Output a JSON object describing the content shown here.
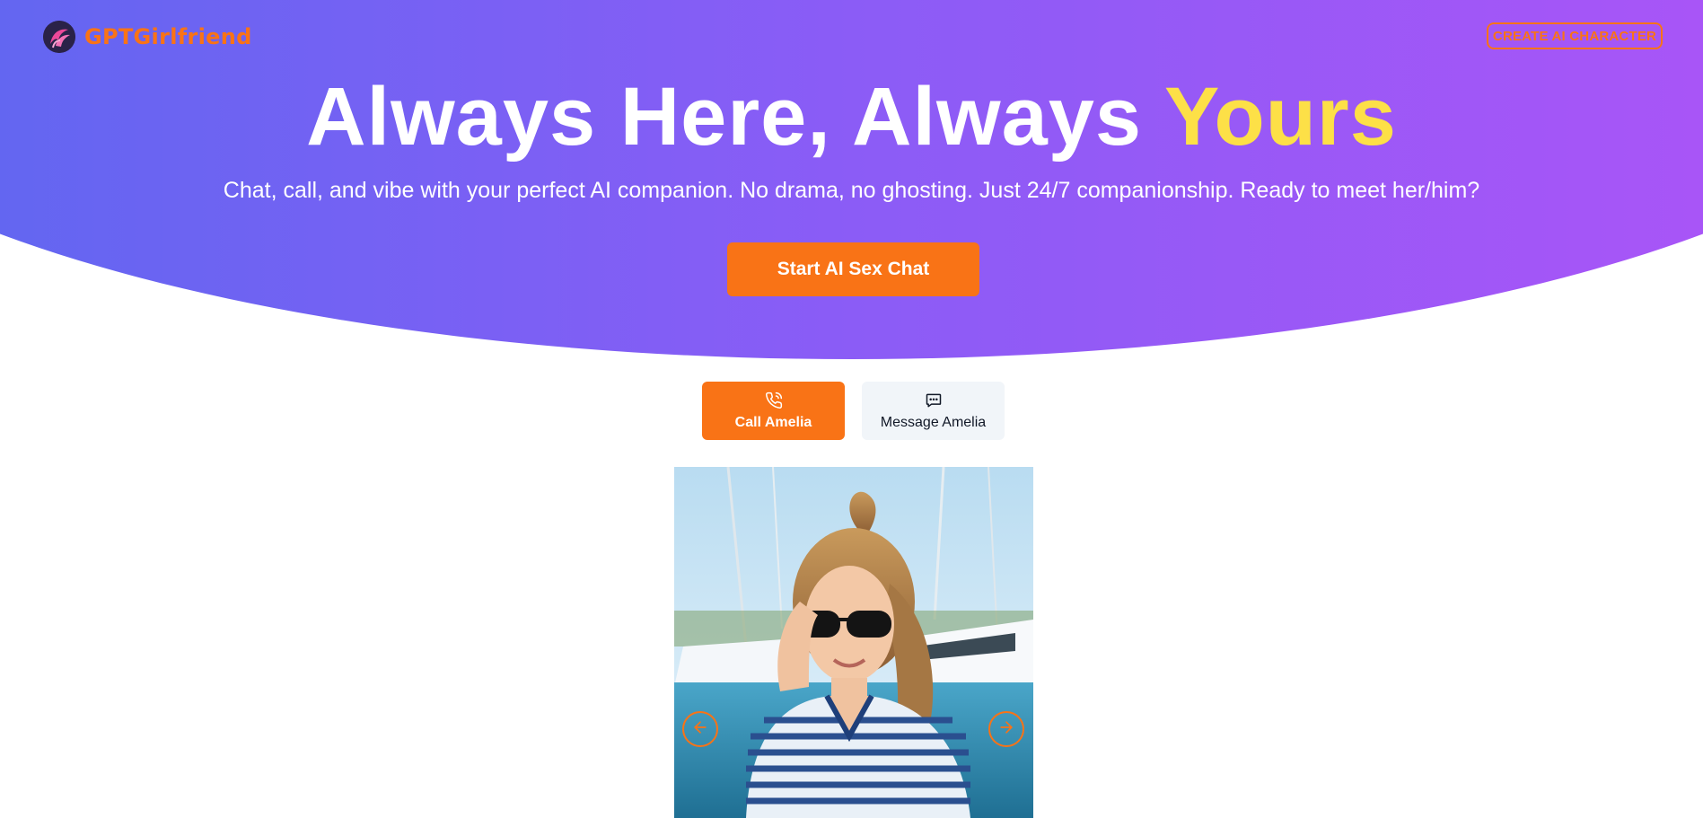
{
  "nav": {
    "brand": "GPTGirlfriend",
    "create_button": "CREATE AI CHARACTER"
  },
  "hero": {
    "headline_main": "Always Here, Always ",
    "headline_accent": "Yours",
    "subheadline": "Chat, call, and vibe with your perfect AI companion. No drama, no ghosting. Just 24/7 companionship. Ready to meet her/him?",
    "cta": "Start AI Sex Chat"
  },
  "tabs": [
    {
      "label": "Call Amelia",
      "icon": "phone-icon",
      "active": true
    },
    {
      "label": "Message Amelia",
      "icon": "message-icon",
      "active": false
    }
  ],
  "colors": {
    "gradient_start": "#6366f1",
    "gradient_end": "#a855f7",
    "accent_orange": "#f97316",
    "accent_yellow": "#fde047"
  }
}
